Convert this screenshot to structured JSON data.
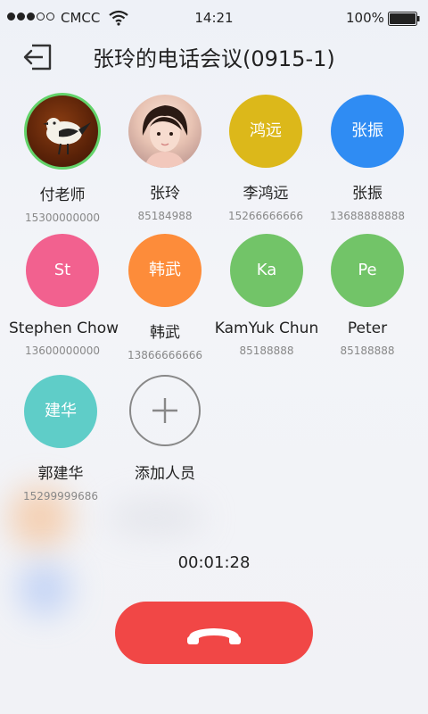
{
  "status_bar": {
    "carrier": "CMCC",
    "time": "14:21",
    "battery": "100%",
    "signal_bars_filled": 3,
    "signal_bars_total": 5
  },
  "header": {
    "back_icon": "back-arrow-icon",
    "title": "张玲的电话会议(0915-1)"
  },
  "members": [
    {
      "name": "付老师",
      "number": "15300000000",
      "avatar_type": "photo"
    },
    {
      "name": "张玲",
      "number": "85184988",
      "avatar_type": "photo"
    },
    {
      "name": "李鸿远",
      "number": "15266666666",
      "avatar_text": "鸿远",
      "color": "#dcb81a"
    },
    {
      "name": "张振",
      "number": "13688888888",
      "avatar_text": "张振",
      "color": "#2f8cf3"
    },
    {
      "name": "Stephen Chow",
      "number": "13600000000",
      "avatar_text": "St",
      "color": "#f2618f"
    },
    {
      "name": "韩武",
      "number": "13866666666",
      "avatar_text": "韩武",
      "color": "#fd8c3a"
    },
    {
      "name": "KamYuk Chun",
      "number": "85188888",
      "avatar_text": "Ka",
      "color": "#72c468"
    },
    {
      "name": "Peter",
      "number": "85188888",
      "avatar_text": "Pe",
      "color": "#72c468"
    },
    {
      "name": "郭建华",
      "number": "15299999686",
      "avatar_text": "建华",
      "color": "#5fcdc8"
    }
  ],
  "add_member": {
    "label": "添加人员",
    "icon": "plus-icon"
  },
  "call": {
    "duration": "00:01:28",
    "hangup_icon": "phone-hangup-icon",
    "hangup_color": "#f14746"
  }
}
